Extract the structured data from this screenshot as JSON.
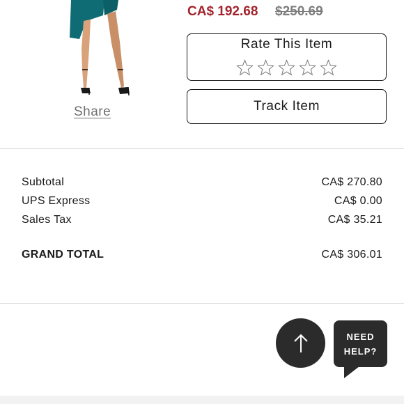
{
  "product": {
    "price_sale": "CA$ 192.68",
    "price_original": "$250.69",
    "share_label": "Share",
    "rate_title": "Rate This Item",
    "rating_max": 5,
    "rating_value": 0,
    "track_label": "Track Item"
  },
  "summary": {
    "rows": [
      {
        "label": "Subtotal",
        "value": "CA$ 270.80"
      },
      {
        "label": "UPS Express",
        "value": "CA$ 0.00"
      },
      {
        "label": "Sales Tax",
        "value": "CA$ 35.21"
      }
    ],
    "grand_label": "GRAND TOTAL",
    "grand_value": "CA$ 306.01"
  },
  "help": {
    "line1": "NEED",
    "line2": "HELP?"
  },
  "icons": {
    "scroll_top": "arrow-up-icon",
    "star": "star-outline-icon"
  },
  "colors": {
    "sale_price": "#a3232b",
    "original_price": "#7d7d7d",
    "dress": "#0f6b74",
    "dark_button": "#2b2b2b"
  }
}
